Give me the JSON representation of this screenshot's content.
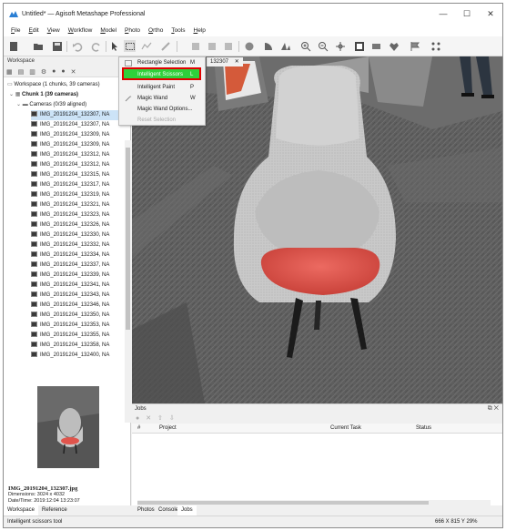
{
  "window": {
    "title": "Untitled* — Agisoft Metashape Professional",
    "minimize": "—",
    "maximize": "☐",
    "close": "✕"
  },
  "menu": [
    "File",
    "Edit",
    "View",
    "Workflow",
    "Model",
    "Photo",
    "Ortho",
    "Tools",
    "Help"
  ],
  "workspace": {
    "header": "Workspace",
    "root": "Workspace (1 chunks, 39 cameras)",
    "chunk": "Chunk 1 (39 cameras)",
    "cameras_folder": "Cameras (0/39 aligned)",
    "cameras": [
      "IMG_20191204_132307, NA",
      "IMG_20191204_132307, NA",
      "IMG_20191204_132309, NA",
      "IMG_20191204_132309, NA",
      "IMG_20191204_132312, NA",
      "IMG_20191204_132312, NA",
      "IMG_20191204_132315, NA",
      "IMG_20191204_132317, NA",
      "IMG_20191204_132319, NA",
      "IMG_20191204_132321, NA",
      "IMG_20191204_132323, NA",
      "IMG_20191204_132326, NA",
      "IMG_20191204_132330, NA",
      "IMG_20191204_132332, NA",
      "IMG_20191204_132334, NA",
      "IMG_20191204_132337, NA",
      "IMG_20191204_132339, NA",
      "IMG_20191204_132341, NA",
      "IMG_20191204_132343, NA",
      "IMG_20191204_132346, NA",
      "IMG_20191204_132350, NA",
      "IMG_20191204_132353, NA",
      "IMG_20191204_132355, NA",
      "IMG_20191204_132358, NA",
      "IMG_20191204_132400, NA"
    ]
  },
  "thumbnail": {
    "filename": "IMG_20191204_132307.jpg",
    "dimensions": "Dimensions: 3024 x 4032",
    "datetime": "Date/Time: 2019:12:04 13:23:07"
  },
  "left_tabs": [
    "Workspace",
    "Reference"
  ],
  "context_menu": [
    {
      "label": "Rectangle Selection",
      "key": "M",
      "state": "normal"
    },
    {
      "label": "Intelligent Scissors",
      "key": "L",
      "state": "highlighted"
    },
    {
      "label": "Intelligent Paint",
      "key": "P",
      "state": "normal"
    },
    {
      "label": "Magic Wand",
      "key": "W",
      "state": "normal"
    },
    {
      "label": "Magic Wand Options...",
      "key": "",
      "state": "normal"
    },
    {
      "label": "Reset Selection",
      "key": "",
      "state": "disabled"
    }
  ],
  "photo_tab": "132307",
  "photo_tab_close": "✕",
  "jobs": {
    "header": "Jobs",
    "columns": [
      "#",
      "Project",
      "Current Task",
      "Status"
    ]
  },
  "bottom_tabs": [
    "Photos",
    "Console",
    "Jobs"
  ],
  "status": {
    "left": "Intelligent scissors tool",
    "right": "666 X  815 Y  29%"
  },
  "colors": {
    "highlight_green": "#2fd13b",
    "annotation_red": "#e00000",
    "selection_blue": "#cce3f7",
    "seat_red": "#e0544c"
  }
}
